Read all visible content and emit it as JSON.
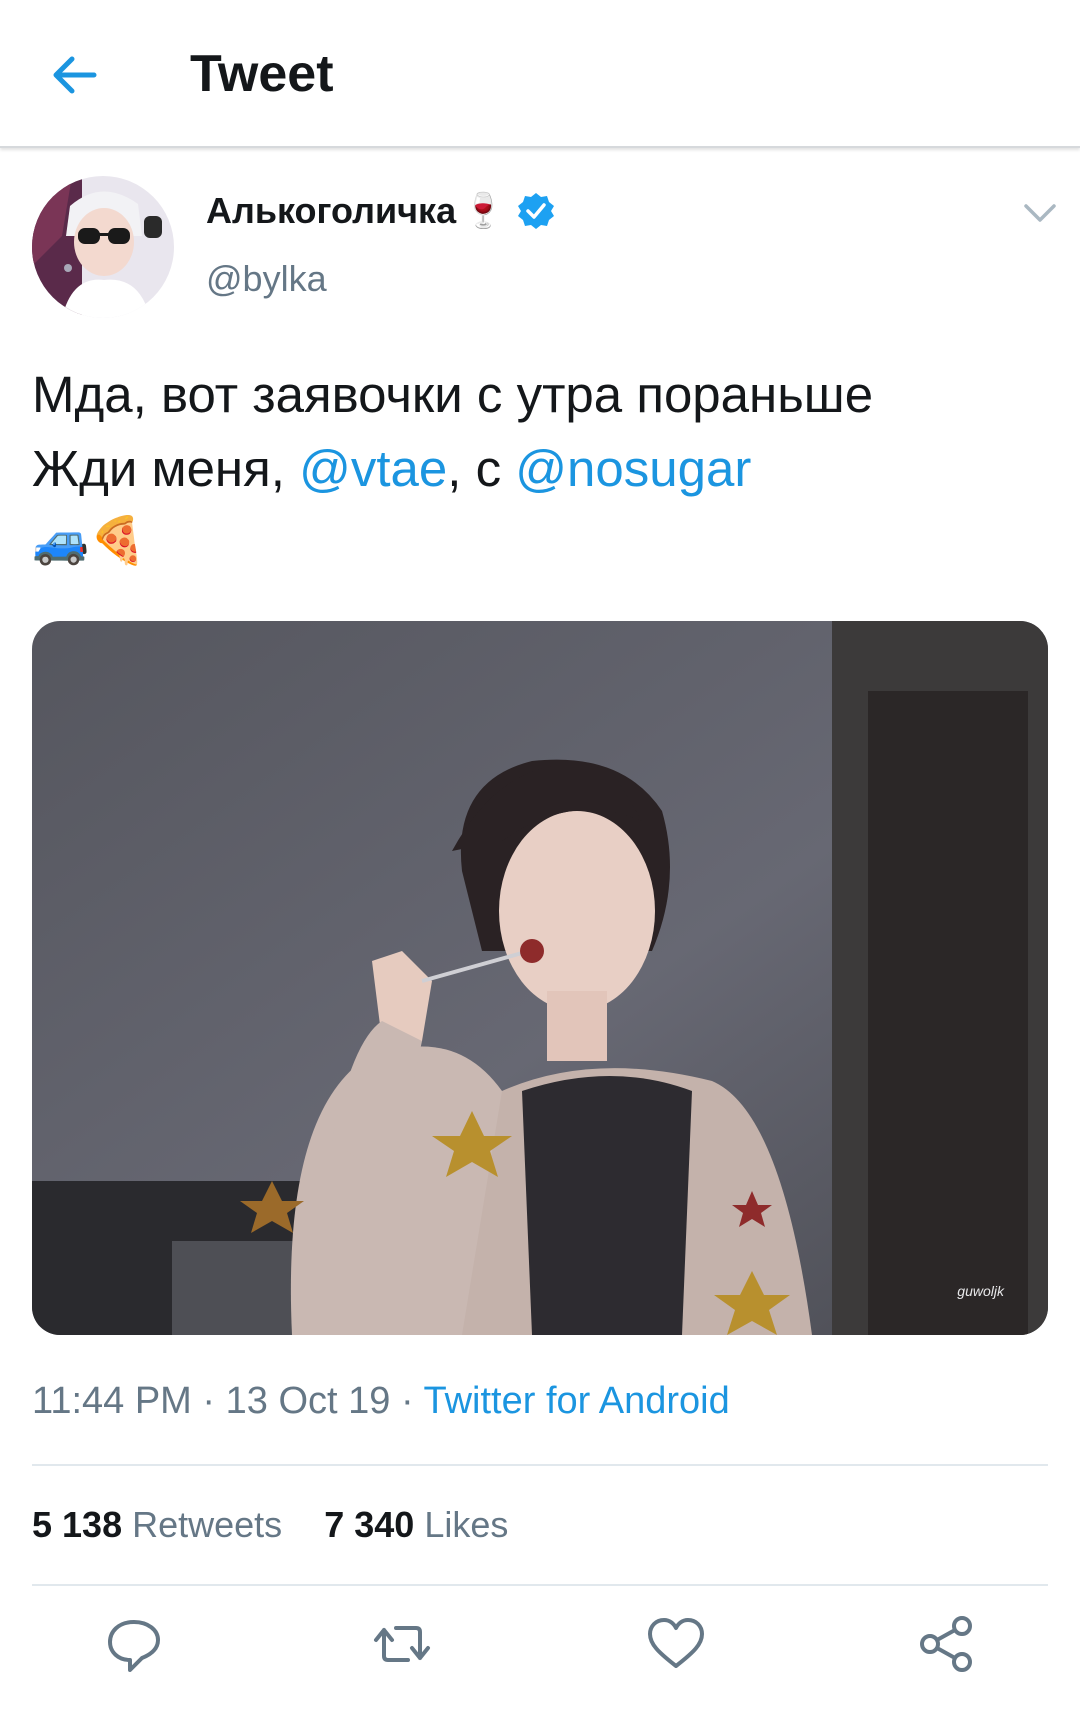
{
  "header": {
    "title": "Tweet",
    "back_icon": "arrow-left-icon"
  },
  "author": {
    "display_name": "Алькоголичка",
    "name_emoji": "🍷",
    "verified_icon": "verified-badge-icon",
    "handle": "@bylka"
  },
  "tweet": {
    "line1": "Мда, вот заявочки с утра пораньше",
    "line2_prefix": "Жди меня, ",
    "mention1": "@vtae",
    "line2_middle": ", с ",
    "mention2": "@nosugar",
    "emojis": "🚙🍕"
  },
  "photo": {
    "watermark": "guwoljk"
  },
  "meta": {
    "time": "11:44 PM",
    "sep1": " · ",
    "date": "13 Oct 19",
    "sep2": " · ",
    "source": "Twitter for Android"
  },
  "stats": {
    "retweets_count": "5 138",
    "retweets_label": "Retweets",
    "likes_count": "7 340",
    "likes_label": "Likes"
  },
  "actions": [
    "reply-icon",
    "retweet-icon",
    "like-icon",
    "share-icon"
  ],
  "colors": {
    "accent": "#1b95e0",
    "text": "#14171a",
    "muted": "#657786",
    "divider": "#e1e8ed"
  }
}
